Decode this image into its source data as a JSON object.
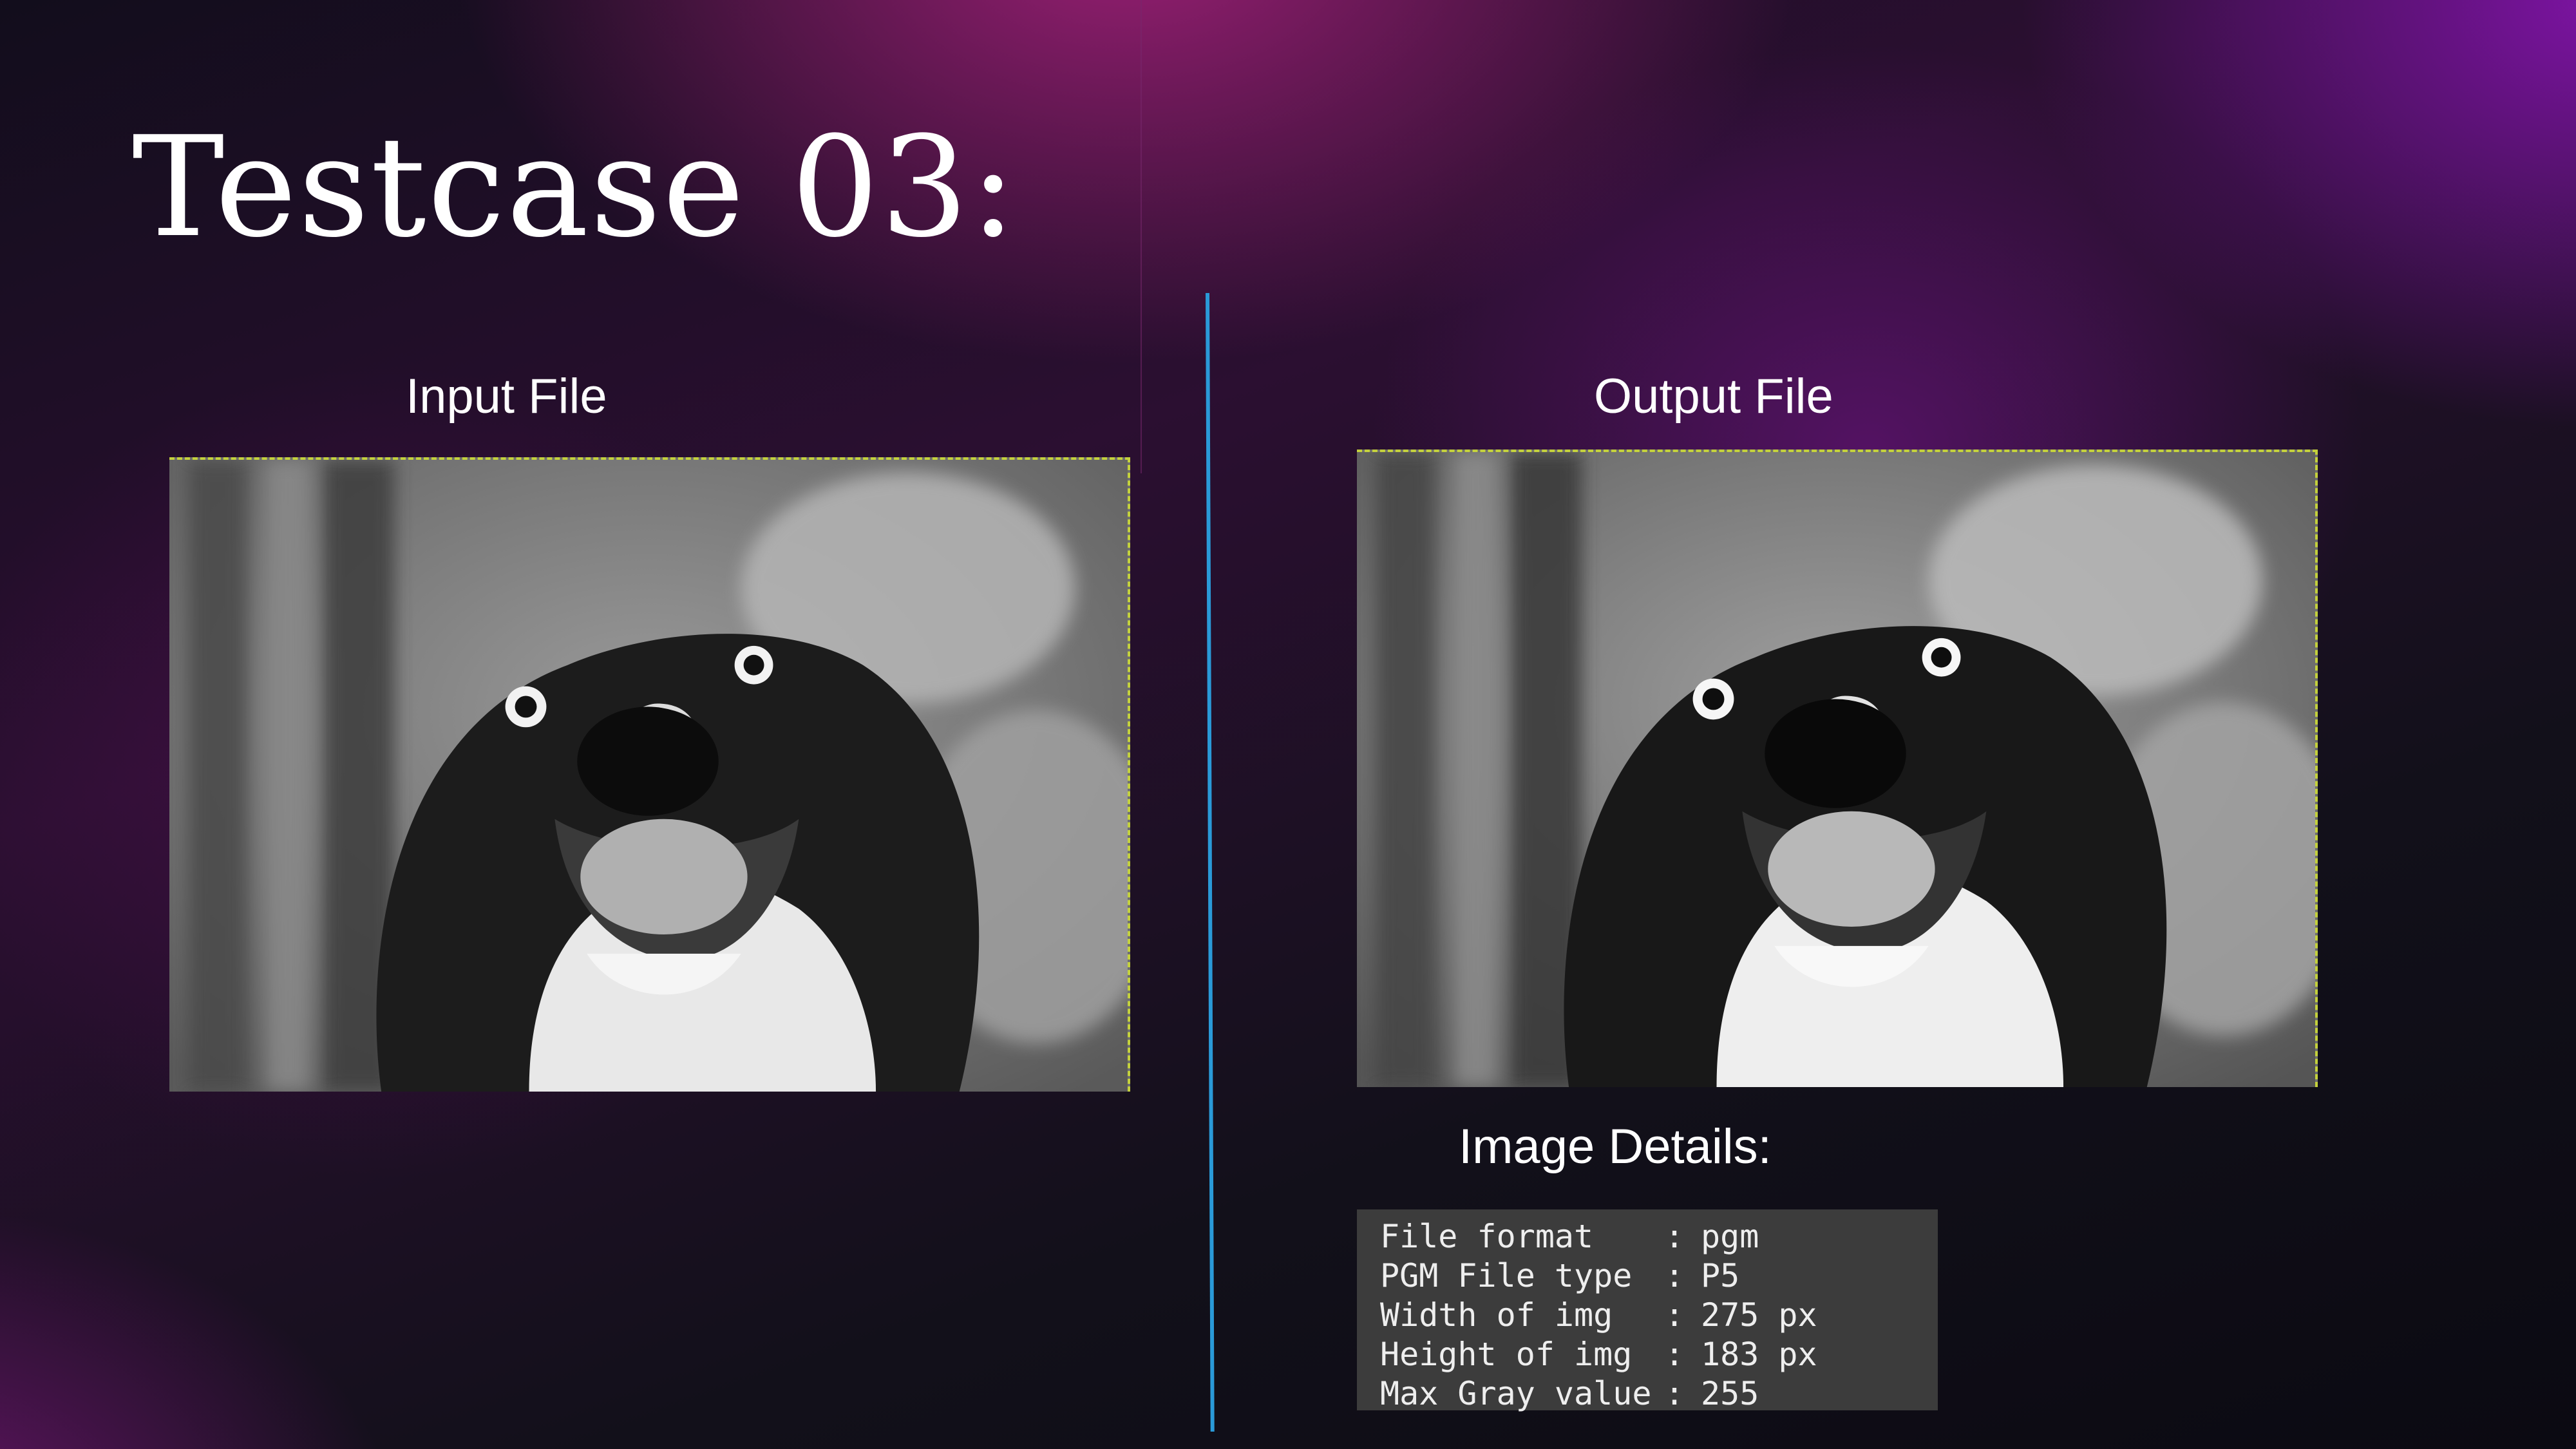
{
  "slide": {
    "title": "Testcase 03:",
    "input_label": "Input File",
    "output_label": "Output File",
    "details_label": "Image Details:"
  },
  "images": {
    "input_alt": "grayscale photo of a smiling dog",
    "output_alt": "grayscale photo of a smiling dog"
  },
  "image_details": [
    {
      "key": "File format",
      "sep": ":",
      "value": "pgm"
    },
    {
      "key": "PGM File type",
      "sep": ":",
      "value": "P5"
    },
    {
      "key": "Width of img",
      "sep": ":",
      "value": "275 px"
    },
    {
      "key": "Height of img",
      "sep": ":",
      "value": "183 px"
    },
    {
      "key": "Max Gray value",
      "sep": ":",
      "value": "255"
    }
  ],
  "colors": {
    "divider": "#2a9ad8",
    "image_border": "#c4d13c",
    "details_bg": "#3c3c3c"
  }
}
